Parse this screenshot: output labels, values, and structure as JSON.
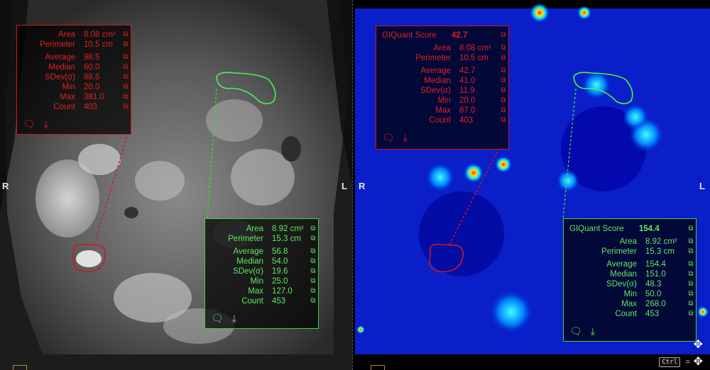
{
  "left": {
    "orient_left": "R",
    "orient_right": "L",
    "roi_red": {
      "rows": [
        {
          "label": "Area",
          "value": "8.08 cm²"
        },
        {
          "label": "Perimeter",
          "value": "10.5 cm"
        },
        {
          "label": "Average",
          "value": "98.5"
        },
        {
          "label": "Median",
          "value": "60.0"
        },
        {
          "label": "SDev(σ)",
          "value": "88.6"
        },
        {
          "label": "Min",
          "value": "20.0"
        },
        {
          "label": "Max",
          "value": "381.0"
        },
        {
          "label": "Count",
          "value": "403"
        }
      ]
    },
    "roi_green": {
      "rows": [
        {
          "label": "Area",
          "value": "8.92 cm²"
        },
        {
          "label": "Perimeter",
          "value": "15.3 cm"
        },
        {
          "label": "Average",
          "value": "56.8"
        },
        {
          "label": "Median",
          "value": "54.0"
        },
        {
          "label": "SDev(σ)",
          "value": "19.6"
        },
        {
          "label": "Min",
          "value": "25.0"
        },
        {
          "label": "Max",
          "value": "127.0"
        },
        {
          "label": "Count",
          "value": "453"
        }
      ]
    }
  },
  "right": {
    "orient_left": "R",
    "orient_right": "L",
    "roi_red": {
      "score_label": "GIQuant Score",
      "score_value": "42.7",
      "rows": [
        {
          "label": "Area",
          "value": "8.08 cm²"
        },
        {
          "label": "Perimeter",
          "value": "10.5 cm"
        },
        {
          "label": "Average",
          "value": "42.7"
        },
        {
          "label": "Median",
          "value": "41.0"
        },
        {
          "label": "SDev(σ)",
          "value": "11.9"
        },
        {
          "label": "Min",
          "value": "20.0"
        },
        {
          "label": "Max",
          "value": "87.0"
        },
        {
          "label": "Count",
          "value": "403"
        }
      ]
    },
    "roi_green": {
      "score_label": "GIQuant Score",
      "score_value": "154.4",
      "rows": [
        {
          "label": "Area",
          "value": "8.92 cm²"
        },
        {
          "label": "Perimeter",
          "value": "15.3 cm"
        },
        {
          "label": "Average",
          "value": "154.4"
        },
        {
          "label": "Median",
          "value": "151.0"
        },
        {
          "label": "SDev(σ)",
          "value": "48.3"
        },
        {
          "label": "Min",
          "value": "50.0"
        },
        {
          "label": "Max",
          "value": "268.0"
        },
        {
          "label": "Count",
          "value": "453"
        }
      ]
    }
  },
  "footer": {
    "ctrl_key": "Ctrl",
    "equals": "="
  },
  "icons": {
    "comment": "comment-icon",
    "download": "download-icon",
    "copy": "copy-icon",
    "move": "move-icon"
  },
  "colors": {
    "roi_red": "#d01818",
    "roi_green": "#3fd23f"
  }
}
